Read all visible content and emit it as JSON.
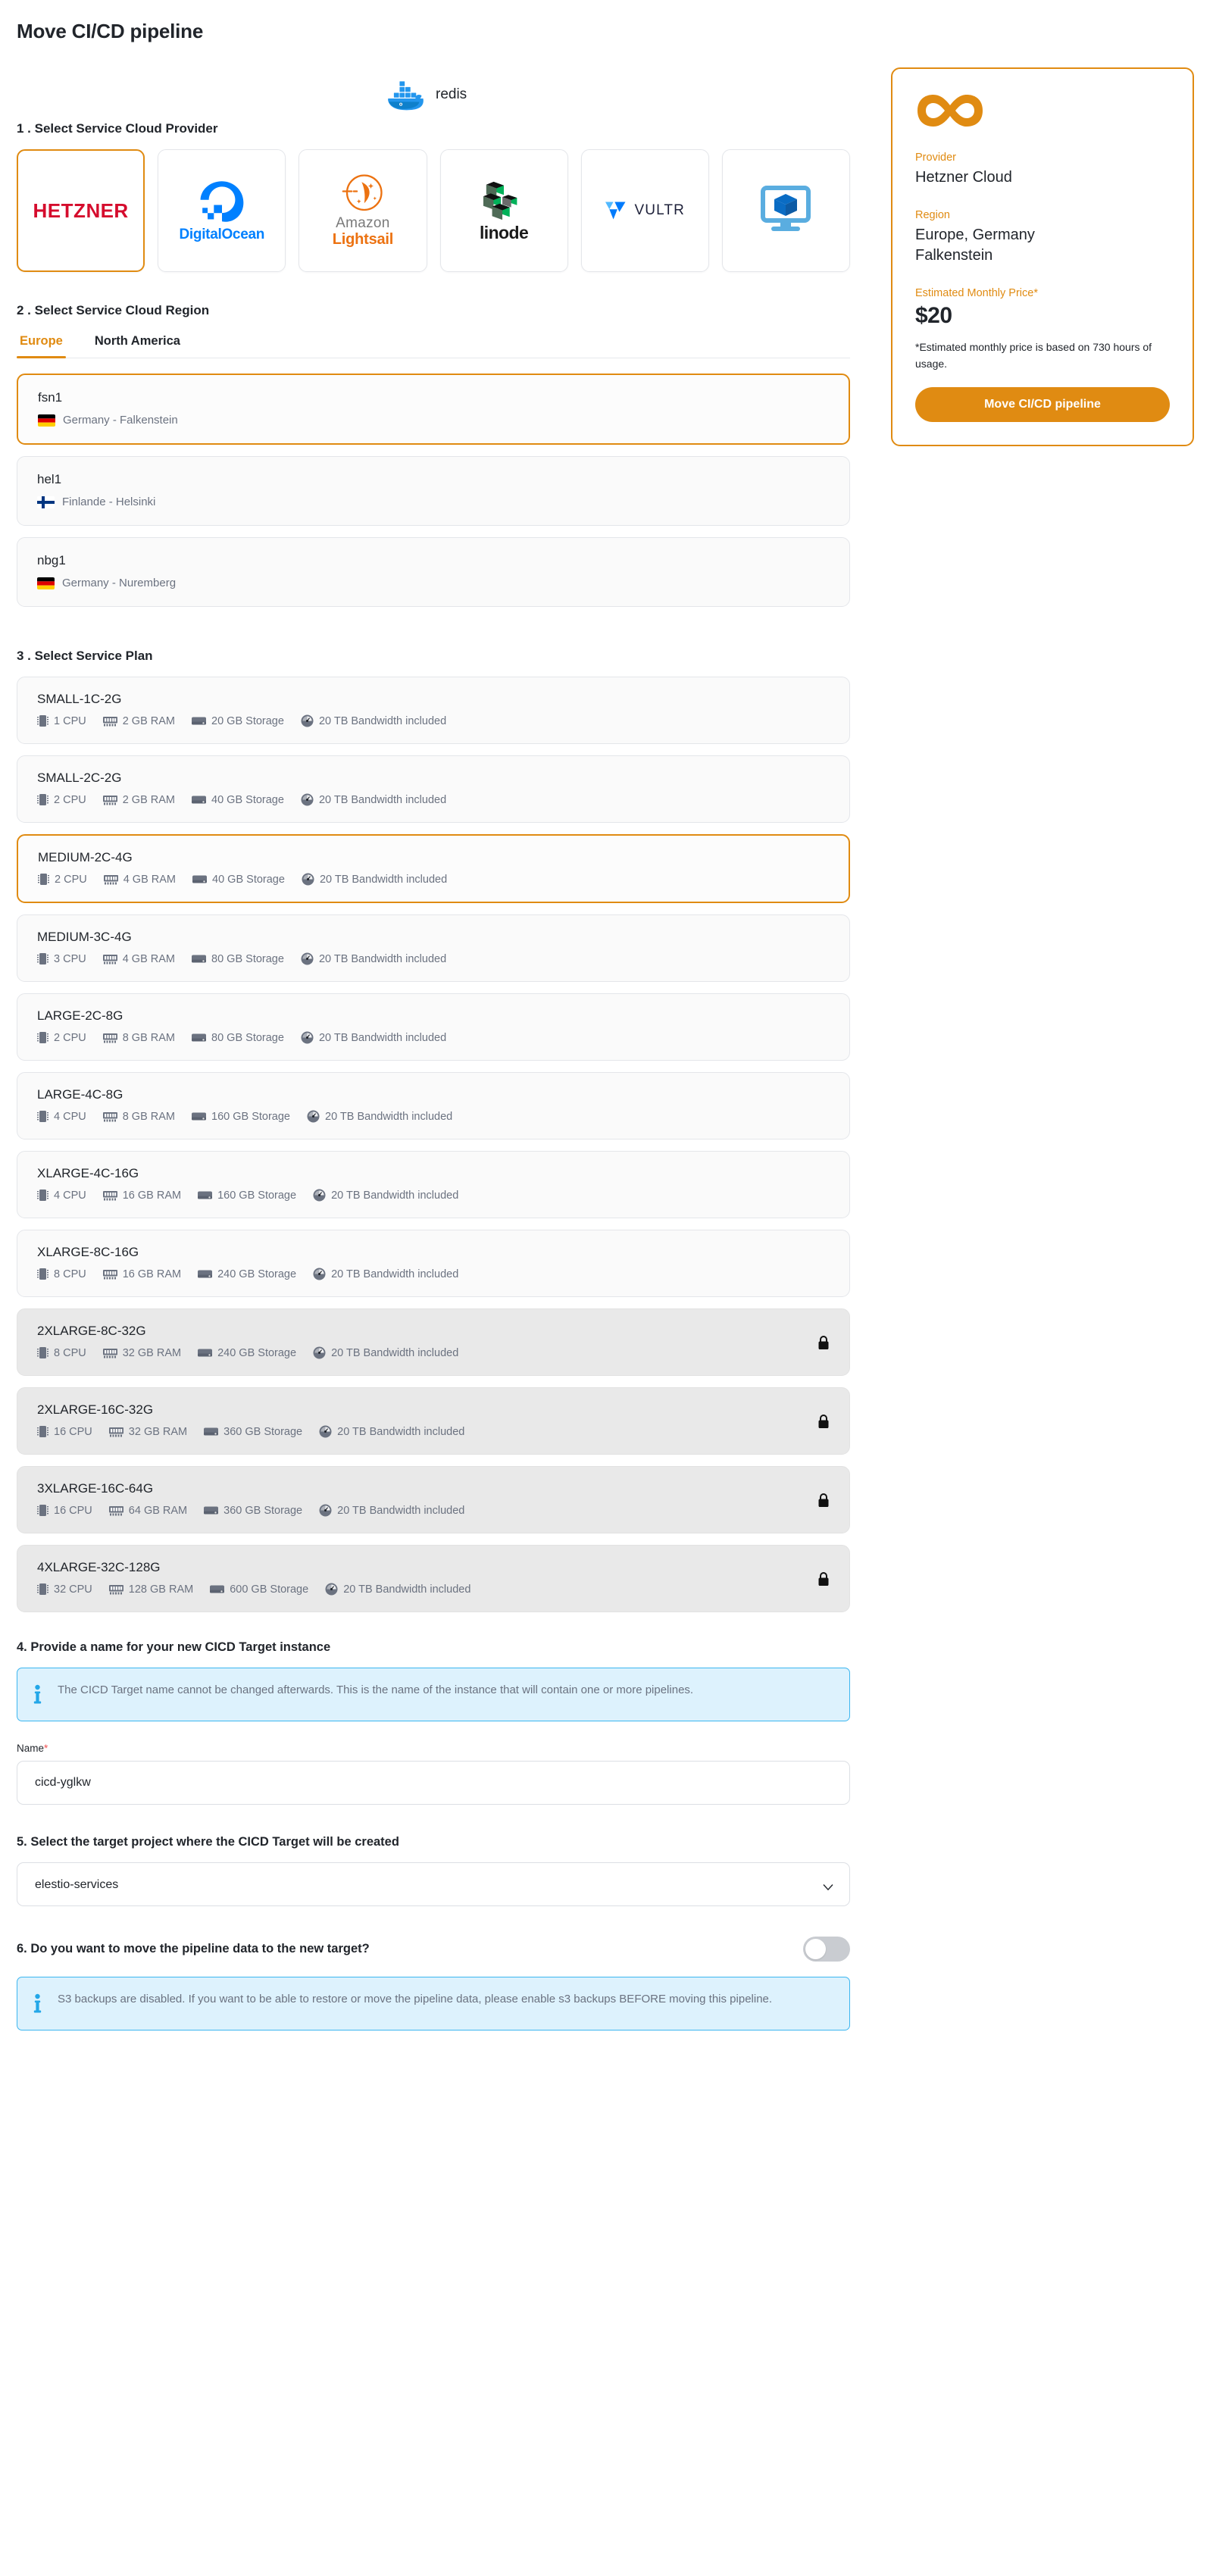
{
  "page_title": "Move CI/CD pipeline",
  "service": {
    "name": "redis",
    "icon": "docker-icon"
  },
  "steps": {
    "provider": "1 . Select Service Cloud Provider",
    "region": "2 . Select Service Cloud Region",
    "plan": "3 . Select Service Plan",
    "name": "4. Provide a name for your new CICD Target instance",
    "project": "5. Select the target project where the CICD Target will be created",
    "move_data": "6. Do you want to move the pipeline data to the new target?"
  },
  "providers": [
    {
      "id": "hetzner",
      "label": "HETZNER",
      "icon": "hetzner-logo-icon",
      "selected": true
    },
    {
      "id": "digitalocean",
      "label": "DigitalOcean",
      "icon": "digitalocean-logo-icon",
      "selected": false
    },
    {
      "id": "lightsail",
      "label": "Amazon Lightsail",
      "line1": "Amazon",
      "line2": "Lightsail",
      "icon": "amazon-lightsail-logo-icon",
      "selected": false
    },
    {
      "id": "linode",
      "label": "linode",
      "icon": "linode-logo-icon",
      "selected": false
    },
    {
      "id": "vultr",
      "label": "VULTR",
      "icon": "vultr-logo-icon",
      "selected": false
    },
    {
      "id": "generic",
      "label": "",
      "icon": "server-monitor-icon",
      "selected": false
    }
  ],
  "region_tabs": [
    {
      "label": "Europe",
      "active": true
    },
    {
      "label": "North America",
      "active": false
    }
  ],
  "regions": [
    {
      "code": "fsn1",
      "location": "Germany - Falkenstein",
      "flag": "germany-flag-icon",
      "selected": true
    },
    {
      "code": "hel1",
      "location": "Finlande - Helsinki",
      "flag": "finland-flag-icon",
      "selected": false
    },
    {
      "code": "nbg1",
      "location": "Germany - Nuremberg",
      "flag": "germany-flag-icon",
      "selected": false
    }
  ],
  "plans": [
    {
      "name": "SMALL-1C-2G",
      "cpu": "1 CPU",
      "ram": "2 GB RAM",
      "storage": "20 GB Storage",
      "bandwidth": "20 TB Bandwidth included",
      "selected": false,
      "locked": false
    },
    {
      "name": "SMALL-2C-2G",
      "cpu": "2 CPU",
      "ram": "2 GB RAM",
      "storage": "40 GB Storage",
      "bandwidth": "20 TB Bandwidth included",
      "selected": false,
      "locked": false
    },
    {
      "name": "MEDIUM-2C-4G",
      "cpu": "2 CPU",
      "ram": "4 GB RAM",
      "storage": "40 GB Storage",
      "bandwidth": "20 TB Bandwidth included",
      "selected": true,
      "locked": false
    },
    {
      "name": "MEDIUM-3C-4G",
      "cpu": "3 CPU",
      "ram": "4 GB RAM",
      "storage": "80 GB Storage",
      "bandwidth": "20 TB Bandwidth included",
      "selected": false,
      "locked": false
    },
    {
      "name": "LARGE-2C-8G",
      "cpu": "2 CPU",
      "ram": "8 GB RAM",
      "storage": "80 GB Storage",
      "bandwidth": "20 TB Bandwidth included",
      "selected": false,
      "locked": false
    },
    {
      "name": "LARGE-4C-8G",
      "cpu": "4 CPU",
      "ram": "8 GB RAM",
      "storage": "160 GB Storage",
      "bandwidth": "20 TB Bandwidth included",
      "selected": false,
      "locked": false
    },
    {
      "name": "XLARGE-4C-16G",
      "cpu": "4 CPU",
      "ram": "16 GB RAM",
      "storage": "160 GB Storage",
      "bandwidth": "20 TB Bandwidth included",
      "selected": false,
      "locked": false
    },
    {
      "name": "XLARGE-8C-16G",
      "cpu": "8 CPU",
      "ram": "16 GB RAM",
      "storage": "240 GB Storage",
      "bandwidth": "20 TB Bandwidth included",
      "selected": false,
      "locked": false
    },
    {
      "name": "2XLARGE-8C-32G",
      "cpu": "8 CPU",
      "ram": "32 GB RAM",
      "storage": "240 GB Storage",
      "bandwidth": "20 TB Bandwidth included",
      "selected": false,
      "locked": true
    },
    {
      "name": "2XLARGE-16C-32G",
      "cpu": "16 CPU",
      "ram": "32 GB RAM",
      "storage": "360 GB Storage",
      "bandwidth": "20 TB Bandwidth included",
      "selected": false,
      "locked": true
    },
    {
      "name": "3XLARGE-16C-64G",
      "cpu": "16 CPU",
      "ram": "64 GB RAM",
      "storage": "360 GB Storage",
      "bandwidth": "20 TB Bandwidth included",
      "selected": false,
      "locked": true
    },
    {
      "name": "4XLARGE-32C-128G",
      "cpu": "32 CPU",
      "ram": "128 GB RAM",
      "storage": "600 GB Storage",
      "bandwidth": "20 TB Bandwidth included",
      "selected": false,
      "locked": true
    }
  ],
  "name_alert": "The CICD Target name cannot be changed afterwards. This is the name of the instance that will contain one or more pipelines.",
  "name_field": {
    "label": "Name",
    "required_mark": "*",
    "value": "cicd-yglkw",
    "placeholder": ""
  },
  "project_select": {
    "value": "elestio-services",
    "options": [
      "elestio-services"
    ]
  },
  "move_data": {
    "enabled": false
  },
  "backup_alert": "S3 backups are disabled. If you want to be able to restore or move the pipeline data, please enable s3 backups BEFORE moving this pipeline.",
  "summary": {
    "provider_label": "Provider",
    "provider_value": "Hetzner Cloud",
    "region_label": "Region",
    "region_value": "Europe, Germany\nFalkenstein",
    "region_value_line1": "Europe, Germany",
    "region_value_line2": "Falkenstein",
    "price_label": "Estimated Monthly Price*",
    "price_value": "$20",
    "price_note": "*Estimated monthly price is based on 730 hours of usage.",
    "cta_label": "Move CI/CD pipeline"
  },
  "colors": {
    "accent": "#e08b12",
    "info_bg": "#ddf2fd",
    "info_border": "#3cb6f0",
    "required": "#f05252",
    "locked_bg": "#e9e9e9"
  }
}
